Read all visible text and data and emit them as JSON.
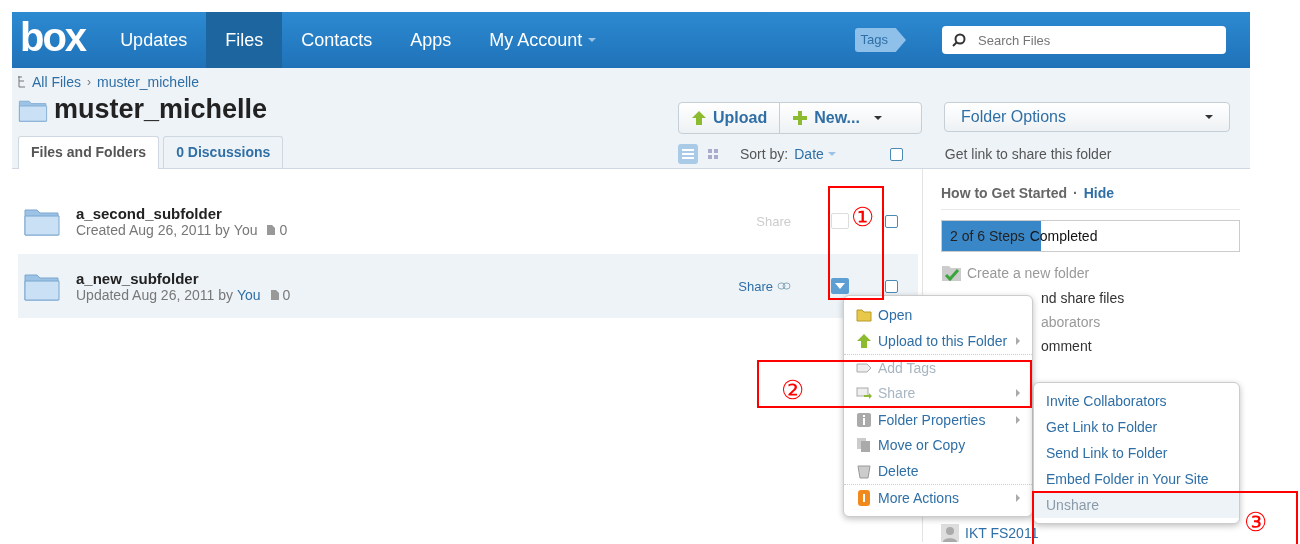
{
  "header": {
    "logo": "box",
    "nav": [
      {
        "label": "Updates",
        "selected": false,
        "caret": false
      },
      {
        "label": "Files",
        "selected": true,
        "caret": false
      },
      {
        "label": "Contacts",
        "selected": false,
        "caret": false
      },
      {
        "label": "Apps",
        "selected": false,
        "caret": false
      },
      {
        "label": "My Account",
        "selected": false,
        "caret": true
      }
    ],
    "tags": "Tags",
    "search": {
      "placeholder": "Search Files"
    }
  },
  "breadcrumb": [
    "All Files",
    "›",
    "muster_michelle"
  ],
  "title": "muster_michelle",
  "tabs": [
    {
      "label": "Files and Folders",
      "selected": true
    },
    {
      "label": "0 Discussions",
      "selected": false
    }
  ],
  "toolbar": {
    "upload": "Upload",
    "new": "New...",
    "folder_options": "Folder Options",
    "sort_label": "Sort by:",
    "sort_value": "Date",
    "get_link": "Get link to share this folder",
    "select_all_checked": false
  },
  "files": [
    {
      "name": "a_second_subfolder",
      "meta": "Created Aug 26, 2011 by",
      "author": "You",
      "author_link": false,
      "count": "0",
      "share": "Share",
      "selected": false,
      "checked": false
    },
    {
      "name": "a_new_subfolder",
      "meta": "Updated Aug 26, 2011 by",
      "author": "You",
      "author_link": true,
      "count": "0",
      "share": "Share",
      "selected": true,
      "checked": false
    }
  ],
  "sidebar": {
    "title": "How to Get Started",
    "separator": "·",
    "hide": "Hide",
    "progress": {
      "level": 0.333,
      "steps": "2 of 6 Steps",
      "completed": "Completed"
    },
    "steps": [
      {
        "text": "Create a new folder",
        "done": true,
        "covered": false
      },
      {
        "text": "nd share files",
        "done": false,
        "covered": true
      },
      {
        "text": "aborators",
        "done": true,
        "covered": true
      },
      {
        "text": "omment",
        "done": false,
        "covered": true
      }
    ],
    "user": "IKT FS2011"
  },
  "menu": [
    {
      "label": "Open",
      "disabled": false,
      "submenu": false,
      "separator": false
    },
    {
      "label": "Upload to this Folder",
      "disabled": false,
      "submenu": true,
      "separator": false
    },
    {
      "label": "Add Tags",
      "disabled": true,
      "submenu": false,
      "separator": true
    },
    {
      "label": "Share",
      "disabled": true,
      "submenu": true,
      "separator": false
    },
    {
      "label": "Folder Properties",
      "disabled": false,
      "submenu": true,
      "separator": true
    },
    {
      "label": "Move or Copy",
      "disabled": false,
      "submenu": false,
      "separator": false
    },
    {
      "label": "Delete",
      "disabled": false,
      "submenu": false,
      "separator": false
    },
    {
      "label": "More Actions",
      "disabled": false,
      "submenu": true,
      "separator": true
    }
  ],
  "submenu": [
    {
      "label": "Invite Collaborators",
      "selected": false
    },
    {
      "label": "Get Link to Folder",
      "selected": false
    },
    {
      "label": "Send Link to Folder",
      "selected": false
    },
    {
      "label": "Embed Folder in Your Site",
      "selected": false
    },
    {
      "label": "Unshare",
      "selected": true
    }
  ],
  "annotations": [
    "①",
    "②",
    "③"
  ]
}
